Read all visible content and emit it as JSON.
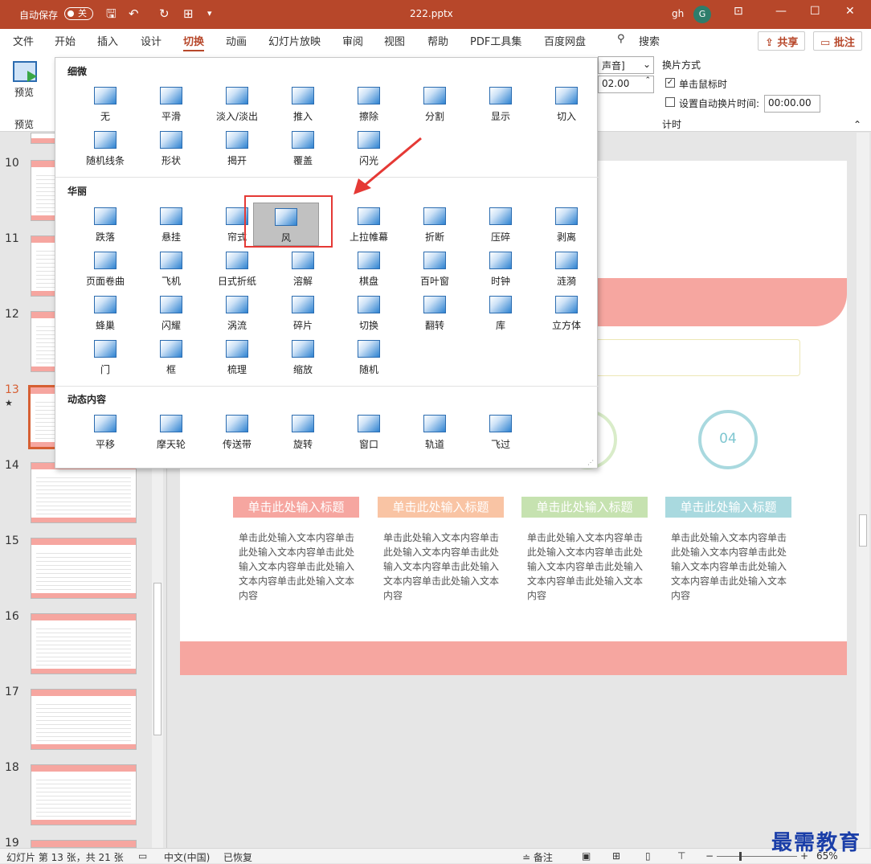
{
  "titlebar": {
    "autosave_label": "自动保存",
    "autosave_state": "关",
    "filename": "222.pptx",
    "user_initials": "gh",
    "avatar_letter": "G"
  },
  "menu": {
    "tabs": [
      "文件",
      "开始",
      "插入",
      "设计",
      "切换",
      "动画",
      "幻灯片放映",
      "审阅",
      "视图",
      "帮助",
      "PDF工具集",
      "百度网盘"
    ],
    "active_tab": "切换",
    "search_label": "搜索",
    "share_label": "共享",
    "comment_label": "批注"
  },
  "ribbon": {
    "preview_label": "预览",
    "preview_group": "预览",
    "sound_value": "声音]",
    "duration_value": "02.00",
    "advance_title": "换片方式",
    "on_click_label": "单击鼠标时",
    "auto_label": "设置自动换片时间:",
    "auto_value": "00:00.00",
    "timing_group": "计时"
  },
  "gallery": {
    "sections": [
      {
        "title": "细微",
        "items": [
          "无",
          "平滑",
          "淡入/淡出",
          "推入",
          "擦除",
          "分割",
          "显示",
          "切入",
          "随机线条",
          "形状",
          "揭开",
          "覆盖",
          "闪光"
        ]
      },
      {
        "title": "华丽",
        "items": [
          "跌落",
          "悬挂",
          "帘式",
          "风",
          "上拉帷幕",
          "折断",
          "压碎",
          "剥离",
          "页面卷曲",
          "飞机",
          "日式折纸",
          "溶解",
          "棋盘",
          "百叶窗",
          "时钟",
          "涟漪",
          "蜂巢",
          "闪耀",
          "涡流",
          "碎片",
          "切换",
          "翻转",
          "库",
          "立方体",
          "门",
          "框",
          "梳理",
          "缩放",
          "随机"
        ]
      },
      {
        "title": "动态内容",
        "items": [
          "平移",
          "摩天轮",
          "传送带",
          "旋转",
          "窗口",
          "轨道",
          "飞过"
        ]
      }
    ],
    "highlighted": "风"
  },
  "thumbnails": {
    "numbers": [
      "10",
      "11",
      "12",
      "13",
      "14",
      "15",
      "16",
      "17",
      "18",
      "19"
    ],
    "selected": "13",
    "star": "★"
  },
  "slide": {
    "pin_number": "04",
    "card_titles": [
      "单击此处输入标题",
      "单击此处输入标题",
      "单击此处输入标题",
      "单击此处输入标题"
    ],
    "card_text": "单击此处输入文本内容单击此处输入文本内容单击此处输入文本内容单击此处输入文本内容单击此处输入文本内容",
    "card_colors": [
      "#f6a6a0",
      "#f9c4a4",
      "#c6e2b0",
      "#a9d9df"
    ]
  },
  "status": {
    "slide_info": "幻灯片 第 13 张，共 21 张",
    "language": "中文(中国)",
    "recovered": "已恢复",
    "notes": "备注",
    "zoom": "65%"
  },
  "watermark": "最需教育"
}
